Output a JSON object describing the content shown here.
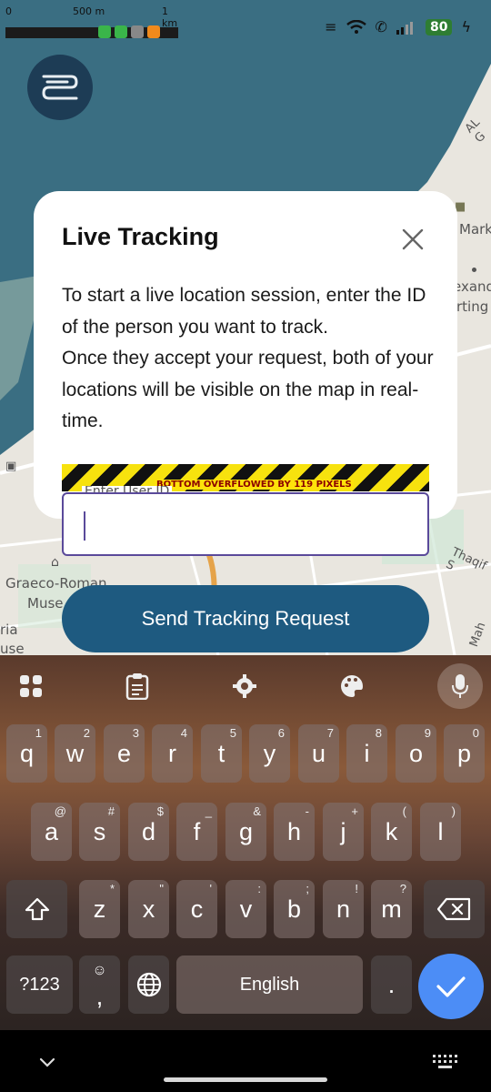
{
  "status_bar": {
    "scale_labels": [
      "0",
      "500 m",
      "1 km"
    ],
    "battery": "80"
  },
  "map": {
    "labels": [
      "AL G",
      "Mark",
      "exand",
      "rting",
      "Thaqif S",
      "Graeco-Roman",
      "Muse",
      "ria",
      "use",
      "Mah"
    ]
  },
  "dialog": {
    "title": "Live Tracking",
    "body_line1": "To start a live location session, enter the ID of the person you want to track.",
    "body_line2": "Once they accept your request, both of your locations will be visible on the map in real-time.",
    "overflow_warning": "BOTTOM OVERFLOWED BY 119 PIXELS",
    "input_label": "Enter User ID",
    "input_value": "",
    "send_button": "Send Tracking Request"
  },
  "keyboard": {
    "row1": [
      {
        "key": "q",
        "hint": "1"
      },
      {
        "key": "w",
        "hint": "2"
      },
      {
        "key": "e",
        "hint": "3"
      },
      {
        "key": "r",
        "hint": "4"
      },
      {
        "key": "t",
        "hint": "5"
      },
      {
        "key": "y",
        "hint": "6"
      },
      {
        "key": "u",
        "hint": "7"
      },
      {
        "key": "i",
        "hint": "8"
      },
      {
        "key": "o",
        "hint": "9"
      },
      {
        "key": "p",
        "hint": "0"
      }
    ],
    "row2": [
      {
        "key": "a",
        "hint": "@"
      },
      {
        "key": "s",
        "hint": "#"
      },
      {
        "key": "d",
        "hint": "$"
      },
      {
        "key": "f",
        "hint": "_"
      },
      {
        "key": "g",
        "hint": "&"
      },
      {
        "key": "h",
        "hint": "-"
      },
      {
        "key": "j",
        "hint": "+"
      },
      {
        "key": "k",
        "hint": "("
      },
      {
        "key": "l",
        "hint": ")"
      }
    ],
    "row3": [
      {
        "key": "z",
        "hint": "*"
      },
      {
        "key": "x",
        "hint": "\""
      },
      {
        "key": "c",
        "hint": "'"
      },
      {
        "key": "v",
        "hint": ":"
      },
      {
        "key": "b",
        "hint": ";"
      },
      {
        "key": "n",
        "hint": "!"
      },
      {
        "key": "m",
        "hint": "?"
      }
    ],
    "symbols_key": "?123",
    "comma_key": ",",
    "emoji_hint": "☺",
    "space_label": "English",
    "period_key": "."
  }
}
